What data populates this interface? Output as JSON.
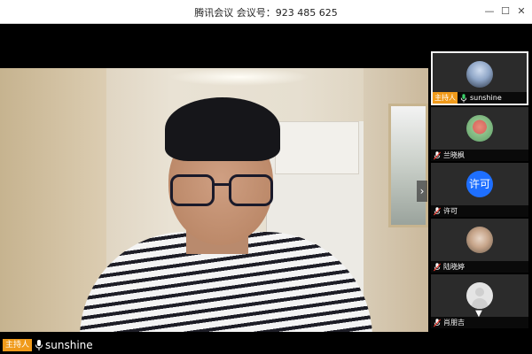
{
  "window": {
    "title": "腾讯会议 会议号：923 485 625",
    "minimize_icon": "minimize-icon",
    "maximize_icon": "maximize-icon",
    "close_icon": "close-icon"
  },
  "main_video": {
    "host_tag": "主持人",
    "speaker_name": "sunshine",
    "mic_icon": "mic-icon",
    "expand_icon": "chevron-right-icon"
  },
  "participants": [
    {
      "name": "sunshine",
      "host_tag": "主持人",
      "is_host": true,
      "active": true,
      "avatar": "photo"
    },
    {
      "name": "兰晓枫",
      "host_tag": "",
      "is_host": false,
      "active": false,
      "avatar": "photo"
    },
    {
      "name": "许可",
      "avatar_text": "许可",
      "host_tag": "",
      "is_host": false,
      "active": false,
      "avatar": "text"
    },
    {
      "name": "陆晓婷",
      "host_tag": "",
      "is_host": false,
      "active": false,
      "avatar": "photo"
    },
    {
      "name": "肖朋吉",
      "host_tag": "",
      "is_host": false,
      "active": false,
      "avatar": "default"
    }
  ],
  "sidebar": {
    "scroll_icon": "chevron-down-icon"
  },
  "colors": {
    "host_tag": "#f09a1a",
    "accent_blue": "#1e6fff",
    "tile_bg": "#2b2b2b"
  }
}
